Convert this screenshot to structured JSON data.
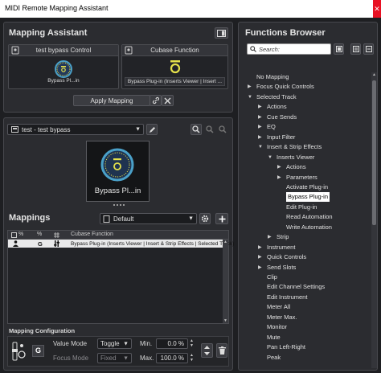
{
  "window": {
    "title": "MIDI Remote Mapping Assistant",
    "close_glyph": "✕"
  },
  "mapping_assistant": {
    "title": "Mapping Assistant",
    "control_header": "test bypass Control",
    "control_label": "Bypass Pl...in",
    "cubase_header": "Cubase Function",
    "cubase_label": "Bypass Plug-in (Inserts Viewer | Insert ...",
    "apply_label": "Apply Mapping"
  },
  "surface": {
    "device_name": "test - test bypass",
    "knob_label": "Bypass Pl...in"
  },
  "mappings": {
    "title": "Mappings",
    "page_name": "Default",
    "columns": [
      "%",
      "%",
      "Cubase Function"
    ],
    "rows": [
      {
        "mode": "G",
        "function": "Bypass Plug-in (Inserts Viewer | Insert & Strip Effects | Selected Track)"
      }
    ]
  },
  "mapping_config": {
    "title": "Mapping Configuration",
    "badge": "G",
    "value_mode_label": "Value Mode",
    "value_mode": "Toggle",
    "focus_mode_label": "Focus Mode",
    "focus_mode": "Fixed",
    "min_label": "Min.",
    "min_value": "0.0 %",
    "max_label": "Max.",
    "max_value": "100.0 %"
  },
  "functions_browser": {
    "title": "Functions Browser",
    "search_placeholder": "Search:",
    "items": [
      {
        "label": "No Mapping",
        "depth": 0,
        "arrow": ""
      },
      {
        "label": "Focus Quick Controls",
        "depth": 0,
        "arrow": "▶"
      },
      {
        "label": "Selected Track",
        "depth": 0,
        "arrow": "▼"
      },
      {
        "label": "Actions",
        "depth": 1,
        "arrow": "▶"
      },
      {
        "label": "Cue Sends",
        "depth": 1,
        "arrow": "▶"
      },
      {
        "label": "EQ",
        "depth": 1,
        "arrow": "▶"
      },
      {
        "label": "Input Filter",
        "depth": 1,
        "arrow": "▶"
      },
      {
        "label": "Insert & Strip Effects",
        "depth": 1,
        "arrow": "▼"
      },
      {
        "label": "Inserts Viewer",
        "depth": 2,
        "arrow": "▼"
      },
      {
        "label": "Actions",
        "depth": 3,
        "arrow": "▶"
      },
      {
        "label": "Parameters",
        "depth": 3,
        "arrow": "▶"
      },
      {
        "label": "Activate Plug-in",
        "depth": 3,
        "arrow": ""
      },
      {
        "label": "Bypass Plug-in",
        "depth": 3,
        "arrow": "",
        "selected": true
      },
      {
        "label": "Edit Plug-in",
        "depth": 3,
        "arrow": ""
      },
      {
        "label": "Read Automation",
        "depth": 3,
        "arrow": ""
      },
      {
        "label": "Write Automation",
        "depth": 3,
        "arrow": ""
      },
      {
        "label": "Strip",
        "depth": 2,
        "arrow": "▶"
      },
      {
        "label": "Instrument",
        "depth": 1,
        "arrow": "▶"
      },
      {
        "label": "Quick Controls",
        "depth": 1,
        "arrow": "▶"
      },
      {
        "label": "Send Slots",
        "depth": 1,
        "arrow": "▶"
      },
      {
        "label": "Clip",
        "depth": 1,
        "arrow": ""
      },
      {
        "label": "Edit Channel Settings",
        "depth": 1,
        "arrow": ""
      },
      {
        "label": "Edit Instrument",
        "depth": 1,
        "arrow": ""
      },
      {
        "label": "Meter All",
        "depth": 1,
        "arrow": ""
      },
      {
        "label": "Meter Max.",
        "depth": 1,
        "arrow": ""
      },
      {
        "label": "Monitor",
        "depth": 1,
        "arrow": ""
      },
      {
        "label": "Mute",
        "depth": 1,
        "arrow": ""
      },
      {
        "label": "Pan Left-Right",
        "depth": 1,
        "arrow": ""
      },
      {
        "label": "Peak",
        "depth": 1,
        "arrow": ""
      }
    ]
  },
  "colors": {
    "accent_yellow": "#e5e14b",
    "knob_blue": "#4aa0c8",
    "selection": "#ffffff"
  }
}
